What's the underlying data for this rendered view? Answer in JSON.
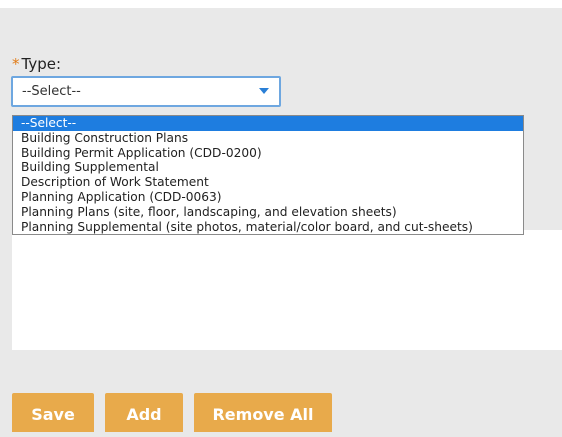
{
  "form": {
    "required_marker": "*",
    "type_label": "Type:",
    "type_value": "--Select--"
  },
  "dropdown": {
    "options": [
      "--Select--",
      "Building Construction Plans",
      "Building Permit Application (CDD-0200)",
      "Building Supplemental",
      "Description of Work Statement",
      "Planning Application (CDD-0063)",
      "Planning Plans (site, floor, landscaping, and elevation sheets)",
      "Planning Supplemental (site photos, material/color board, and cut-sheets)"
    ],
    "selected_index": 0
  },
  "buttons": {
    "save_label": "Save",
    "add_label": "Add",
    "remove_all_label": "Remove All"
  },
  "colors": {
    "required_star": "#e07b17",
    "button_bg": "#e8aa4b",
    "selected_option_bg": "#1e7de0",
    "select_border": "#6ea7e0"
  }
}
